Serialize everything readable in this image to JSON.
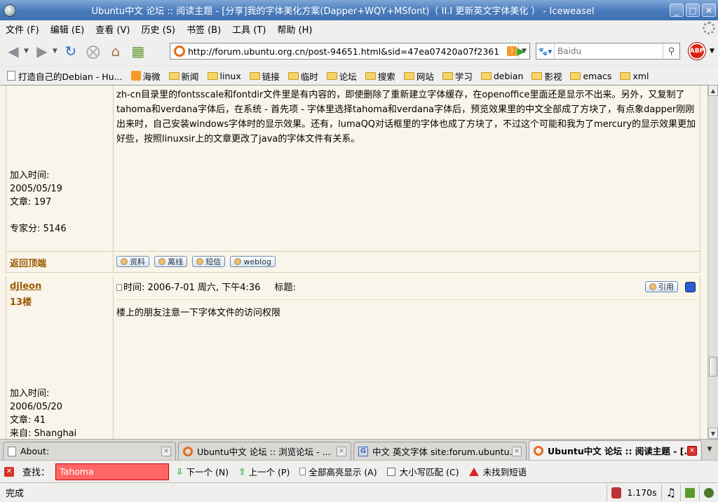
{
  "window": {
    "title": "Ubuntu中文 论坛 :: 阅读主题 - [分享]我的字体美化方案(Dapper+WQY+MSfont)（ II.I 更新英文字体美化 ） - Iceweasel",
    "minimize": "_",
    "maximize": "□",
    "close": "✕"
  },
  "menu": [
    "文件 (F)",
    "编辑 (E)",
    "查看 (V)",
    "历史 (S)",
    "书签 (B)",
    "工具 (T)",
    "帮助 (H)"
  ],
  "nav": {
    "url": "http://forum.ubuntu.org.cn/post-94651.html&sid=47ea07420a07f2361",
    "search_placeholder": "Baidu",
    "abp": "ABP"
  },
  "bookmarks": [
    {
      "label": "打造自己的Debian - Hu...",
      "icon": "page-icon"
    },
    {
      "label": "海微",
      "icon": "rss-icon"
    },
    {
      "label": "新闻",
      "icon": "folder-icon"
    },
    {
      "label": "linux",
      "icon": "folder-icon"
    },
    {
      "label": "链接",
      "icon": "folder-icon"
    },
    {
      "label": "临时",
      "icon": "folder-icon"
    },
    {
      "label": "论坛",
      "icon": "folder-icon"
    },
    {
      "label": "搜索",
      "icon": "folder-icon"
    },
    {
      "label": "网站",
      "icon": "folder-icon"
    },
    {
      "label": "学习",
      "icon": "folder-icon"
    },
    {
      "label": "debian",
      "icon": "folder-icon"
    },
    {
      "label": "影视",
      "icon": "folder-icon"
    },
    {
      "label": "emacs",
      "icon": "folder-icon"
    },
    {
      "label": "xml",
      "icon": "folder-icon"
    }
  ],
  "post1": {
    "body": "zh-cn目录里的fontsscale和fontdir文件里是有内容的，即使删除了重新建立字体缓存，在openoffice里面还是显示不出来。另外，又复制了tahoma和verdana字体后，在系统 - 首先项 - 字体里选择tahoma和verdana字体后，预览效果里的中文全部成了方块了，有点象dapper刚刚出来时，自己安装windows字体时的显示效果。还有，lumaQQ对话框里的字体也成了方块了，不过这个可能和我为了mercury的显示效果更加好些，按照linuxsir上的文章更改了java的字体文件有关系。",
    "join_label": "加入时间:",
    "join_date": "2005/05/19",
    "posts": "文章: 197",
    "score": "专家分: 5146",
    "back_to_top": "返回顶端",
    "buttons": [
      "资料",
      "离线",
      "短信",
      "weblog"
    ]
  },
  "post2": {
    "author": "djleon",
    "floor": "13楼",
    "time": "时间: 2006-7-01 周六, 下午4:36",
    "subject_label": "标题:",
    "quote": "引用",
    "body": "楼上的朋友注意一下字体文件的访问权限",
    "join_label": "加入时间:",
    "join_date": "2006/05/20",
    "posts": "文章: 41",
    "from": "来自: Shanghai"
  },
  "tabs": [
    {
      "label": "About:",
      "icon": "page",
      "active": false
    },
    {
      "label": "Ubuntu中文 论坛 :: 浏览论坛 - ...",
      "icon": "ubuntu",
      "active": false
    },
    {
      "label": "中文 英文字体 site:forum.ubuntu...",
      "icon": "google",
      "active": false
    },
    {
      "label": "Ubuntu中文 论坛 :: 阅读主题 - [...",
      "icon": "ubuntu",
      "active": true
    }
  ],
  "find": {
    "label": "查找：",
    "value": "Tahoma",
    "next": "下一个 (N)",
    "prev": "上一个 (P)",
    "highlight": "全部高亮显示 (A)",
    "match_case": "大小写匹配 (C)",
    "not_found": "未找到短语"
  },
  "status": {
    "text": "完成",
    "time": "1.170s"
  }
}
